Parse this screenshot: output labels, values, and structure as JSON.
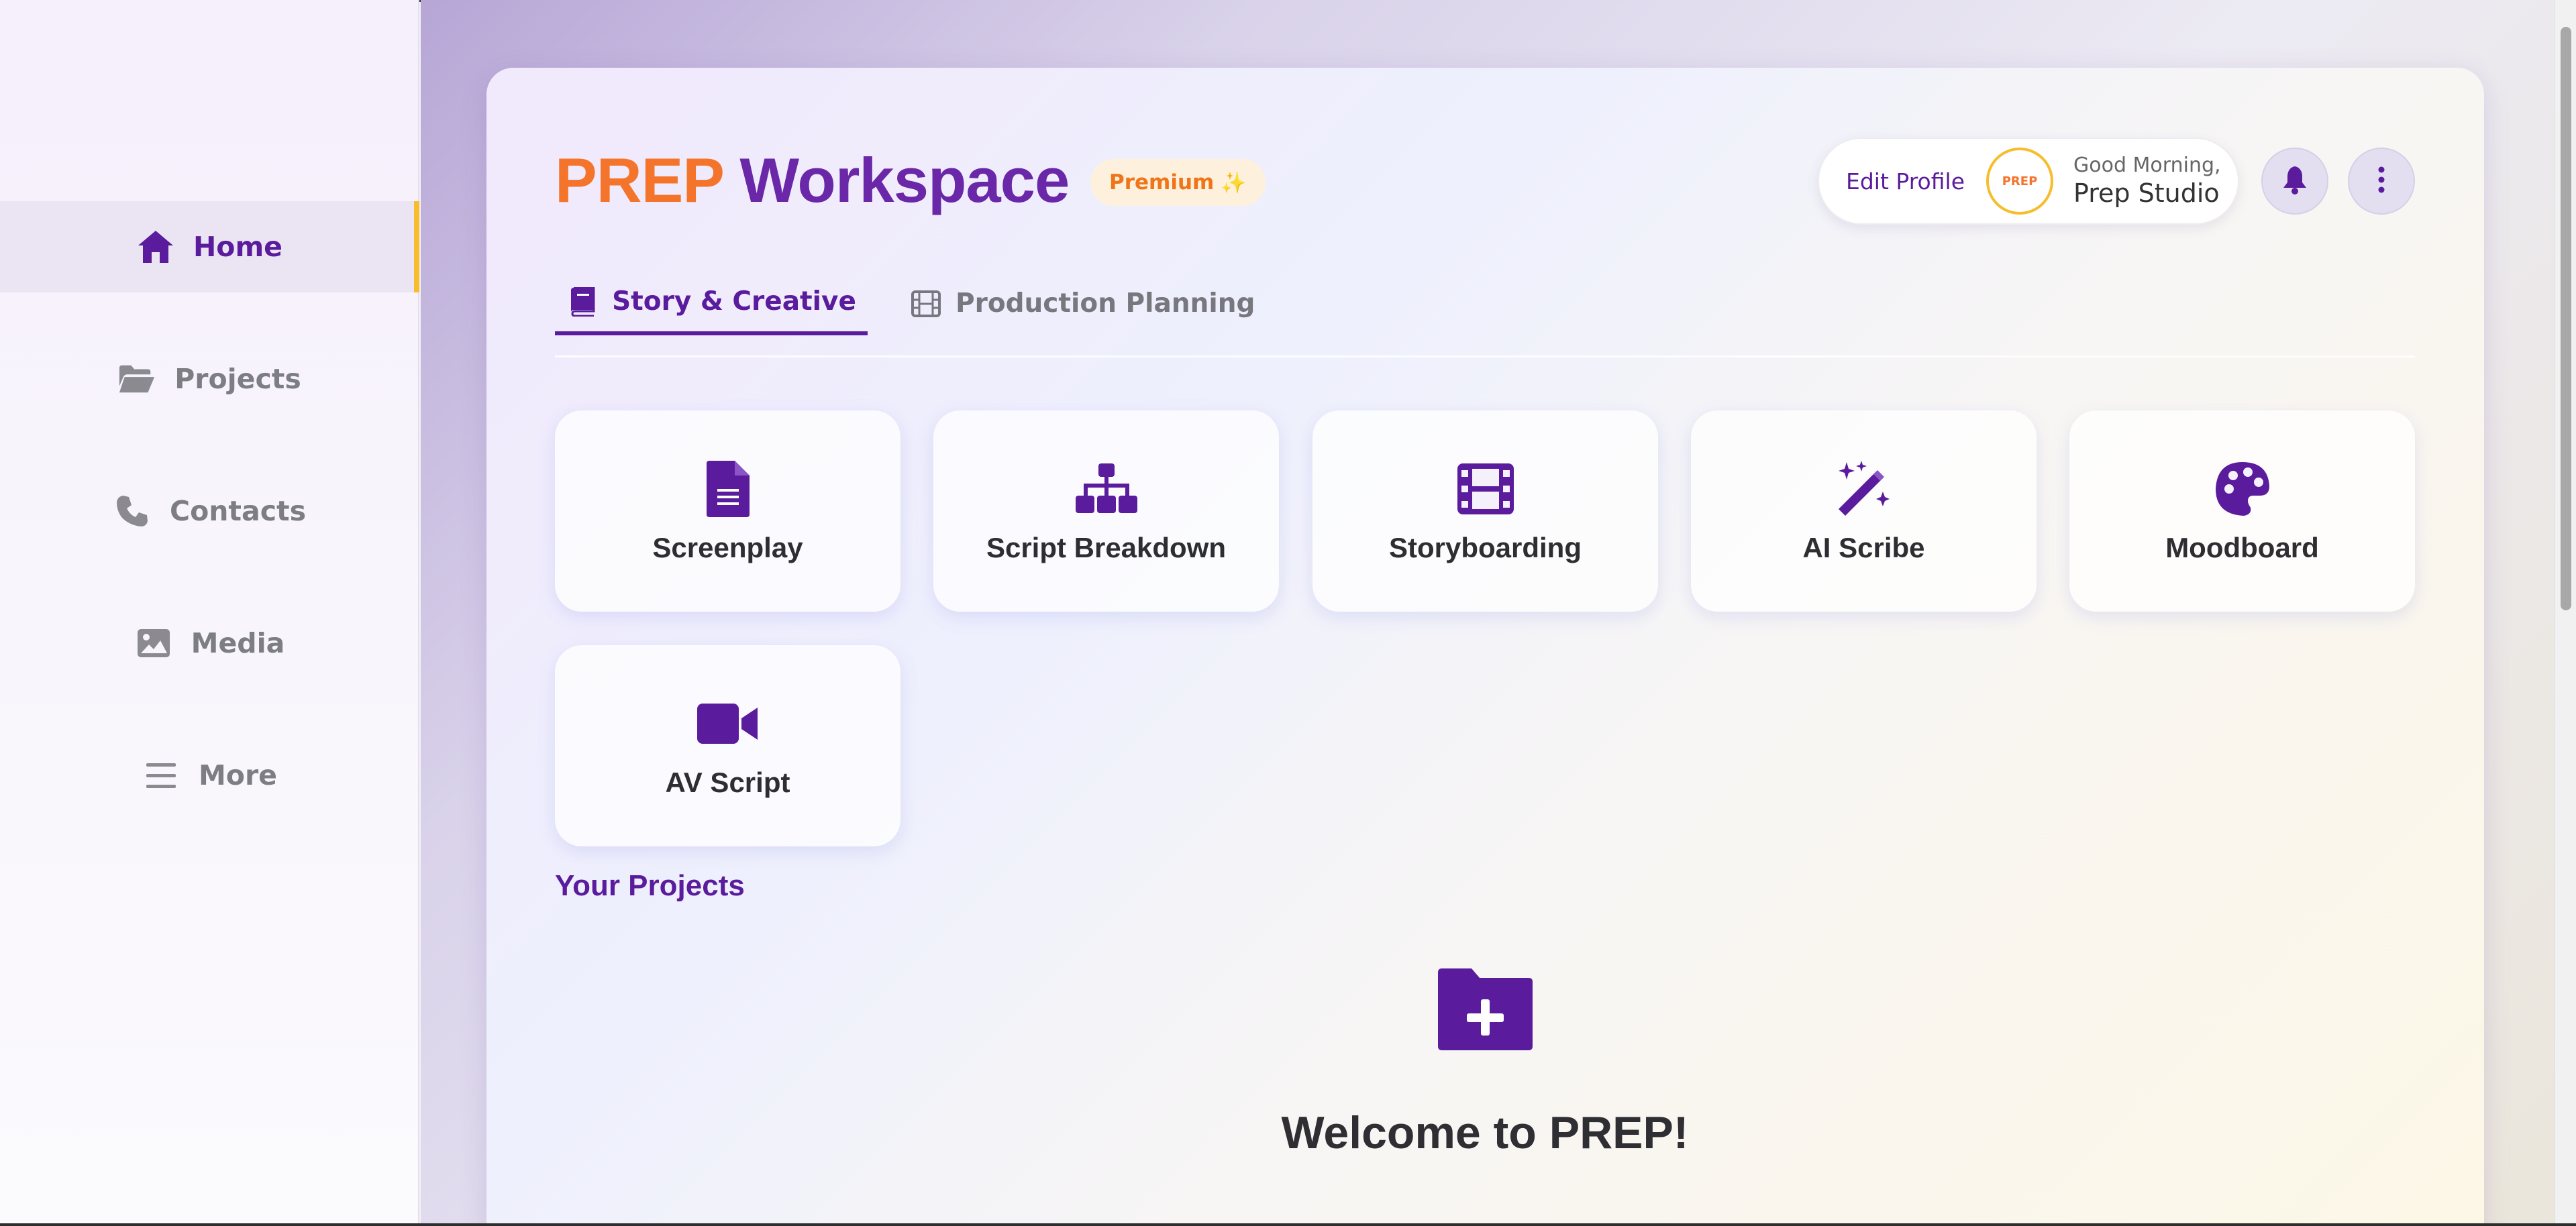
{
  "sidebar": {
    "items": [
      {
        "label": "Home",
        "icon": "home-icon",
        "active": true
      },
      {
        "label": "Projects",
        "icon": "folder-open-icon"
      },
      {
        "label": "Contacts",
        "icon": "phone-icon"
      },
      {
        "label": "Media",
        "icon": "image-icon"
      },
      {
        "label": "More",
        "icon": "menu-icon"
      }
    ]
  },
  "header": {
    "brand": "PREP",
    "title_rest": "Workspace",
    "badge": "Premium",
    "badge_icon": "sparkle-icon",
    "edit_profile": "Edit Profile",
    "avatar_text": "PREP",
    "greeting": "Good Morning,",
    "user_name": "Prep Studio"
  },
  "tabs": [
    {
      "label": "Story & Creative",
      "icon": "book-icon",
      "active": true
    },
    {
      "label": "Production Planning",
      "icon": "film-icon"
    }
  ],
  "tools": [
    {
      "label": "Screenplay",
      "icon": "document-icon"
    },
    {
      "label": "Script Breakdown",
      "icon": "sitemap-icon"
    },
    {
      "label": "Storyboarding",
      "icon": "film-icon"
    },
    {
      "label": "AI Scribe",
      "icon": "magic-wand-icon"
    },
    {
      "label": "Moodboard",
      "icon": "palette-icon"
    },
    {
      "label": "AV Script",
      "icon": "video-camera-icon"
    }
  ],
  "projects": {
    "section_title": "Your Projects",
    "empty_icon": "folder-plus-icon",
    "welcome": "Welcome to PREP!"
  },
  "colors": {
    "primary": "#5a1c9c",
    "brand_orange": "#f4742b",
    "accent_yellow": "#f6bd2c"
  }
}
